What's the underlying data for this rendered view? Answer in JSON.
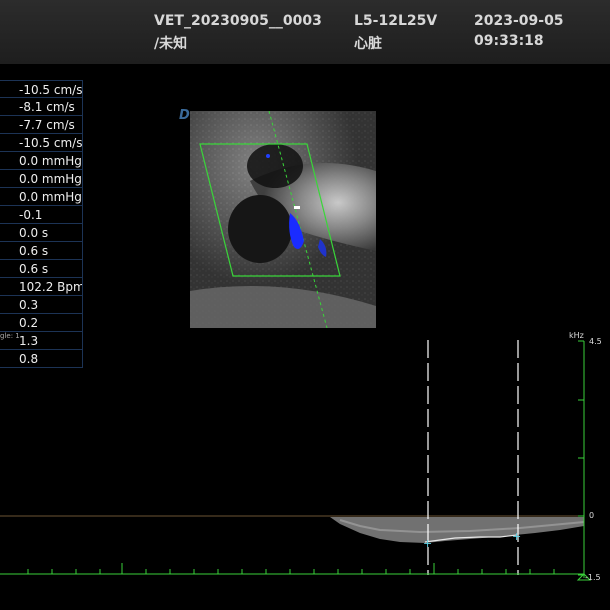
{
  "header": {
    "patient_id": "VET_20230905__0003",
    "patient_sub": "/未知",
    "probe": "L5-12L25V",
    "exam": "心脏",
    "date": "2023-09-05",
    "time": "09:33:18"
  },
  "measurements": [
    "-10.5 cm/s",
    "-8.1 cm/s",
    "-7.7 cm/s",
    "-10.5 cm/s",
    "0.0 mmHg",
    "0.0 mmHg",
    "0.0 mmHg",
    "-0.1",
    "0.0 s",
    "0.6 s",
    "0.6 s",
    "102.2 Bpm",
    "0.3",
    "0.2",
    "1.3",
    "0.8"
  ],
  "angle_label": "gle: 1",
  "image_marker": "D",
  "doppler": {
    "scale_unit": "kHz",
    "scale_max": "4.5",
    "scale_zero": "0",
    "scale_min": "-1.5"
  },
  "colors": {
    "header_bg": "#262626",
    "scale_green": "#3ad13a",
    "roi_green": "#39d639",
    "flow_blue": "#1a2cff"
  }
}
